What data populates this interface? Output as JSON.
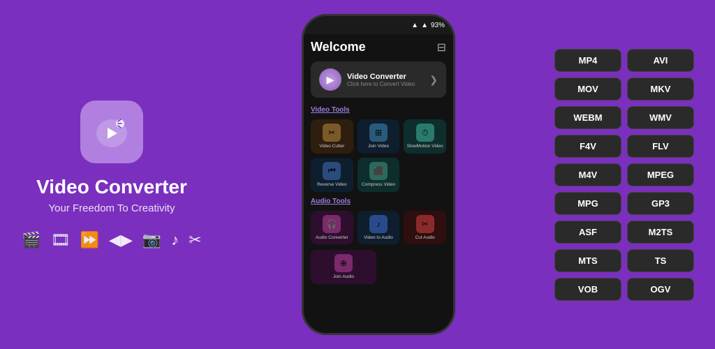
{
  "app": {
    "title": "Video Converter",
    "subtitle": "Your Freedom To Creativity",
    "icon_symbol": "▶"
  },
  "phone": {
    "status": {
      "signal": "▲▼",
      "wifi": "▲",
      "battery": "93%"
    },
    "header": {
      "title": "Welcome"
    },
    "banner": {
      "title": "Video Converter",
      "subtitle": "Click here to Convert Video"
    },
    "video_tools_label": "Video Tools",
    "video_tools": [
      {
        "label": "Video Cutter",
        "color": "#3a2a1a",
        "icon": "✂",
        "icon_bg": "#8B6B3A"
      },
      {
        "label": "Join Video",
        "color": "#1a2a3a",
        "icon": "⊞",
        "icon_bg": "#3A6B8B"
      },
      {
        "label": "SlowMotion Video",
        "color": "#1a2a2a",
        "icon": "⏱",
        "icon_bg": "#3A8B7B"
      },
      {
        "label": "Reverse Video",
        "color": "#1a2a3a",
        "icon": "⏮",
        "icon_bg": "#3A5B8B"
      },
      {
        "label": "Compress Video",
        "color": "#1a2a2a",
        "icon": "⬛",
        "icon_bg": "#3A7B6B"
      }
    ],
    "audio_tools_label": "Audio Tools",
    "audio_tools": [
      {
        "label": "Audio Converter",
        "color": "#2a1a2a",
        "icon": "🎧",
        "icon_bg": "#8B3A7B"
      },
      {
        "label": "Video to Audio",
        "color": "#1a2a3a",
        "icon": "♪",
        "icon_bg": "#3A5B8B"
      },
      {
        "label": "Cut Audio",
        "color": "#2a1a1a",
        "icon": "✂",
        "icon_bg": "#8B3A3A"
      },
      {
        "label": "Join Audio",
        "color": "#2a1a2a",
        "icon": "⊕",
        "icon_bg": "#8B3A7B"
      }
    ]
  },
  "toolbar_icons": [
    "🎬",
    "🎞",
    "⏩",
    "◀▶",
    "📷",
    "♪",
    "✂"
  ],
  "formats": [
    "MP4",
    "AVI",
    "MOV",
    "MKV",
    "WEBM",
    "WMV",
    "F4V",
    "FLV",
    "M4V",
    "MPEG",
    "MPG",
    "GP3",
    "ASF",
    "M2TS",
    "MTS",
    "TS",
    "VOB",
    "OGV"
  ]
}
